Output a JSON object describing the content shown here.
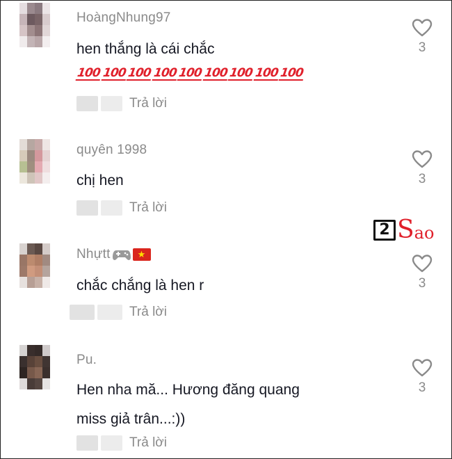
{
  "comments": [
    {
      "username": "HoàngNhung97",
      "text_lines": [
        "hen thắng là cái chắc"
      ],
      "emoji": [
        "100",
        "100",
        "100",
        "100",
        "100",
        "100",
        "100",
        "100",
        "100"
      ],
      "reply_label": "Trả lời",
      "like_count": "3"
    },
    {
      "username": "quyên 1998",
      "text_lines": [
        "chị hen"
      ],
      "reply_label": "Trả lời",
      "like_count": "3"
    },
    {
      "username": "Nhựtt",
      "username_icons": [
        "gamepad-icon",
        "vietnam-flag-icon"
      ],
      "flag_symbol": "★",
      "text_lines": [
        "chắc chắng là hen r"
      ],
      "reply_label": "Trả lời",
      "like_count": "3"
    },
    {
      "username": "Pu.",
      "text_lines": [
        "Hen nha mă... Hương đăng quang",
        "miss giả trân...:))"
      ],
      "reply_label": "Trả lời",
      "like_count": "3"
    }
  ],
  "watermark": {
    "box": "2",
    "s": "S",
    "rest": "ao",
    "brand_color": "#e0202b"
  },
  "colors": {
    "text": "#161823",
    "muted": "#8a8a8a",
    "emoji_red": "#e0202b"
  }
}
